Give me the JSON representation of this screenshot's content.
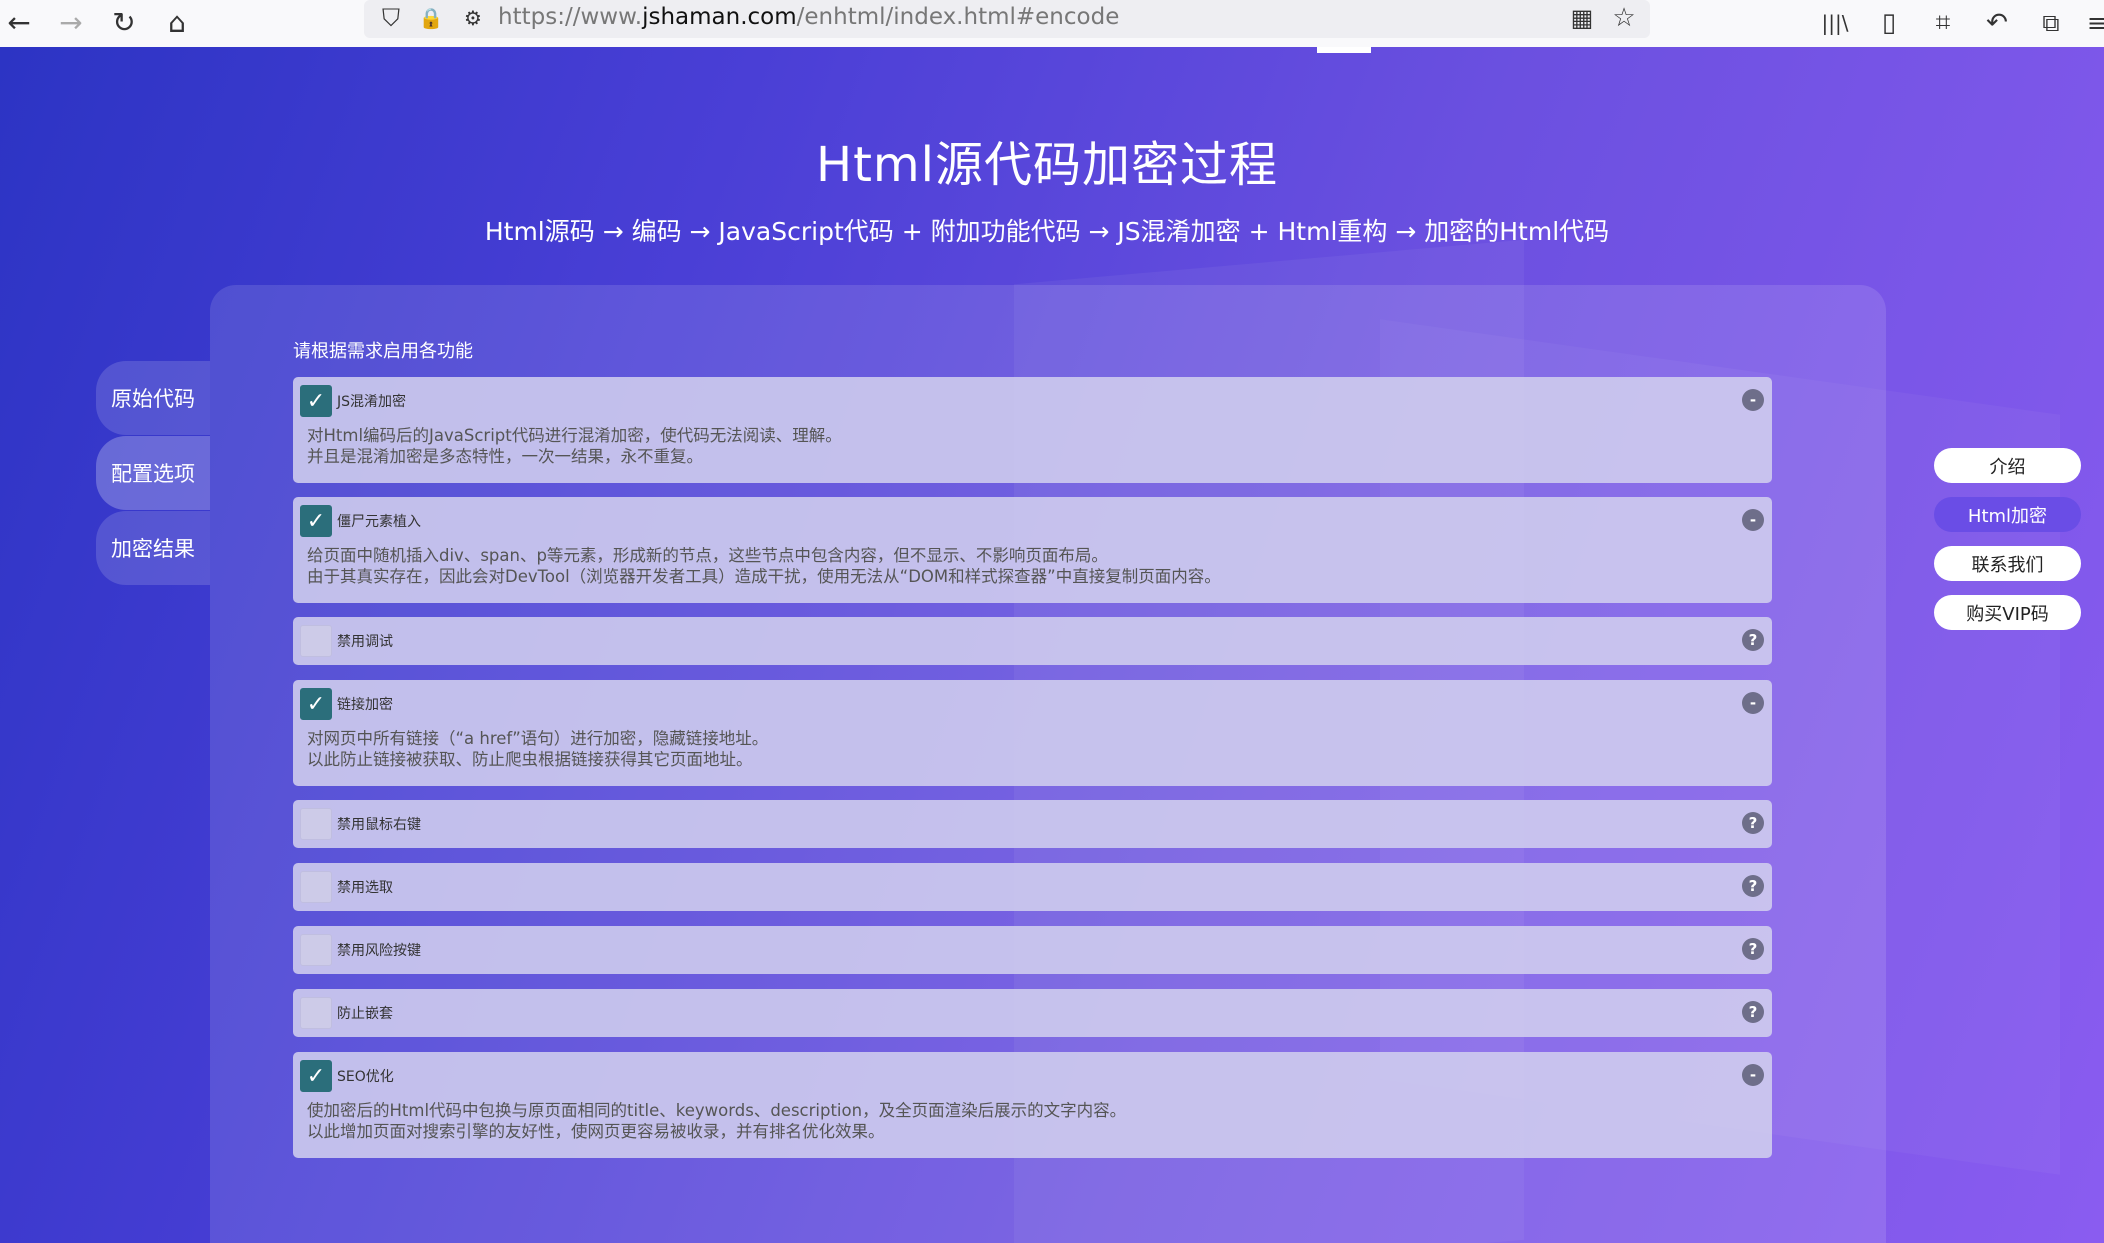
{
  "browser": {
    "url_prefix": "https://www.",
    "url_domain": "jshaman.com",
    "url_path": "/enhtml/index.html#encode"
  },
  "page": {
    "title": "Html源代码加密过程",
    "subtitle": "Html源码 → 编码 → JavaScript代码 + 附加功能代码 → JS混淆加密 + Html重构 → 加密的Html代码",
    "panel_label": "请根据需求启用各功能"
  },
  "side_tabs": [
    {
      "label": "原始代码"
    },
    {
      "label": "配置选项"
    },
    {
      "label": "加密结果"
    }
  ],
  "options": [
    {
      "name": "JS混淆加密",
      "checked": true,
      "badge": "-",
      "desc": "对Html编码后的JavaScript代码进行混淆加密，使代码无法阅读、理解。\n并且是混淆加密是多态特性，一次一结果，永不重复。"
    },
    {
      "name": "僵尸元素植入",
      "checked": true,
      "badge": "-",
      "desc": "给页面中随机插入div、span、p等元素，形成新的节点，这些节点中包含内容，但不显示、不影响页面布局。\n由于其真实存在，因此会对DevTool（浏览器开发者工具）造成干扰，使用无法从“DOM和样式探查器”中直接复制页面内容。"
    },
    {
      "name": "禁用调试",
      "checked": false,
      "badge": "?",
      "desc": ""
    },
    {
      "name": "链接加密",
      "checked": true,
      "badge": "-",
      "desc": "对网页中所有链接（“a href”语句）进行加密，隐藏链接地址。\n以此防止链接被获取、防止爬虫根据链接获得其它页面地址。"
    },
    {
      "name": "禁用鼠标右键",
      "checked": false,
      "badge": "?",
      "desc": ""
    },
    {
      "name": "禁用选取",
      "checked": false,
      "badge": "?",
      "desc": ""
    },
    {
      "name": "禁用风险按键",
      "checked": false,
      "badge": "?",
      "desc": ""
    },
    {
      "name": "防止嵌套",
      "checked": false,
      "badge": "?",
      "desc": ""
    },
    {
      "name": "SEO优化",
      "checked": true,
      "badge": "-",
      "desc": "使加密后的Html代码中包换与原页面相同的title、keywords、description，及全页面渲染后展示的文字内容。\n以此增加页面对搜索引擎的友好性，使网页更容易被收录，并有排名优化效果。"
    }
  ],
  "right_nav": [
    {
      "label": "介绍"
    },
    {
      "label": "Html加密"
    },
    {
      "label": "联系我们"
    },
    {
      "label": "购买VIP码"
    }
  ],
  "icons": {
    "back": "←",
    "forward": "→",
    "reload": "↻",
    "home": "⌂",
    "shield": "⛉",
    "lock": "🔒",
    "tune": "⚙",
    "qr": "▦",
    "star": "☆",
    "library": "|||\\",
    "sidebar": "▯",
    "crop": "⌗",
    "undo": "↶",
    "extensions": "⧉",
    "menu": "≡",
    "check": "✓"
  }
}
